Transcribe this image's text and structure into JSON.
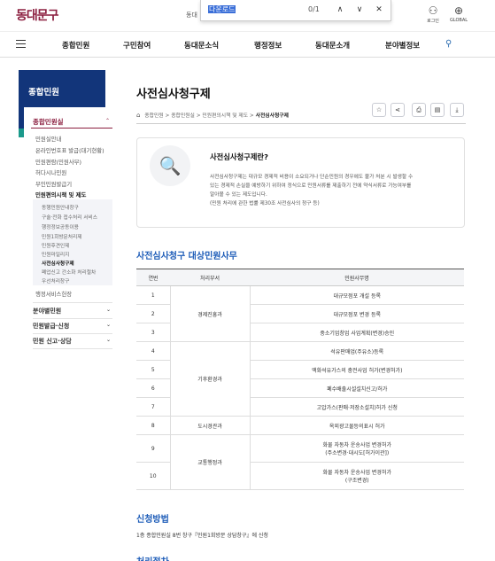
{
  "site": {
    "logo": "동대문구",
    "top_text": "동대"
  },
  "find_bar": {
    "query": "다운로드",
    "count": "0/1",
    "prev": "∧",
    "next": "∨",
    "close": "✕"
  },
  "utility": {
    "login_label": "로그인",
    "global_label": "GLOBAL"
  },
  "nav": {
    "items": [
      "종합민원",
      "구민참여",
      "동대문소식",
      "행정정보",
      "동대문소개",
      "분야별정보"
    ]
  },
  "sidebar": {
    "header": "종합민원",
    "section": "종합민원실",
    "items": [
      "민원실안내",
      "온라인번호표 발급(대기현황)",
      "민원편람(민원사무)",
      "허다시나민원",
      "무인민원발급기",
      "민원편의시책 및 제도"
    ],
    "sub_items": [
      "동행민원안내창구",
      "구술·전화 접수처리 서비스",
      "행정정보공동이용",
      "민원1회방문처리제",
      "민원후견인제",
      "민원마일리지",
      "사전심사청구제",
      "폐업신고 간소화 처리절차",
      "우선처리창구"
    ],
    "extra_item": "행정서비스헌장",
    "categories": [
      "분야별민원",
      "민원발급·신청",
      "민원 신고·상담"
    ]
  },
  "page": {
    "title": "사전심사청구제",
    "breadcrumb": [
      "종합민원",
      "종합민원실",
      "민원편의시책 및 제도",
      "사전심사청구제"
    ],
    "tools": [
      "star",
      "share",
      "print",
      "print-page",
      "download"
    ]
  },
  "intro": {
    "title": "사전심사청구제란?",
    "lines": [
      "사전심사청구제는 대규모 경제적 비용이 소요되거나 단순민원의 경우에도 불가 처분 시 발생할 수",
      "있는 경제적 손실을 예방하기 위하여 정식으로 민원서류를 제출하기 전에 약식서류로 가능여부를",
      "알아볼 수 있는 제도입니다.",
      "(민원 처리에 관한 법률 제30조 사전심사의 청구 등)"
    ]
  },
  "table_section": {
    "title": "사전심사청구 대상민원사무",
    "headers": [
      "연번",
      "처리부서",
      "민원사무명"
    ],
    "rows": [
      {
        "no": "1",
        "task": "대규모점포 개설 등록"
      },
      {
        "no": "2",
        "task": "대규모점포 변경 등록"
      },
      {
        "no": "3",
        "task": "중소기업창업 사업계획(변경)승인"
      },
      {
        "no": "4",
        "task": "석유판매업(주유소)등록"
      },
      {
        "no": "5",
        "task": "액화석유가스의 충전사업 허가(변경허가)"
      },
      {
        "no": "6",
        "task": "폐수배출시설설치신고/허가"
      },
      {
        "no": "7",
        "task": "고압가스(판매·저장소설치)허가 신청"
      },
      {
        "no": "8",
        "task": "옥외광고물등의표시 허가"
      },
      {
        "no": "9",
        "task": "화물 자동차 운송사업 변경허가",
        "task2": "(주소변경·대시도[허가이관])"
      },
      {
        "no": "10",
        "task": "화물 자동차 운송사업 변경허가",
        "task2": "(구조변경)"
      }
    ],
    "departments": [
      "경제진흥과",
      "기후환경과",
      "도시경관과",
      "교통행정과"
    ]
  },
  "apply": {
    "title": "신청방법",
    "text": "1층 종합민원실 8번 창구『민원1회방문 상담창구』에 신청"
  },
  "process": {
    "title": "처리절차"
  }
}
